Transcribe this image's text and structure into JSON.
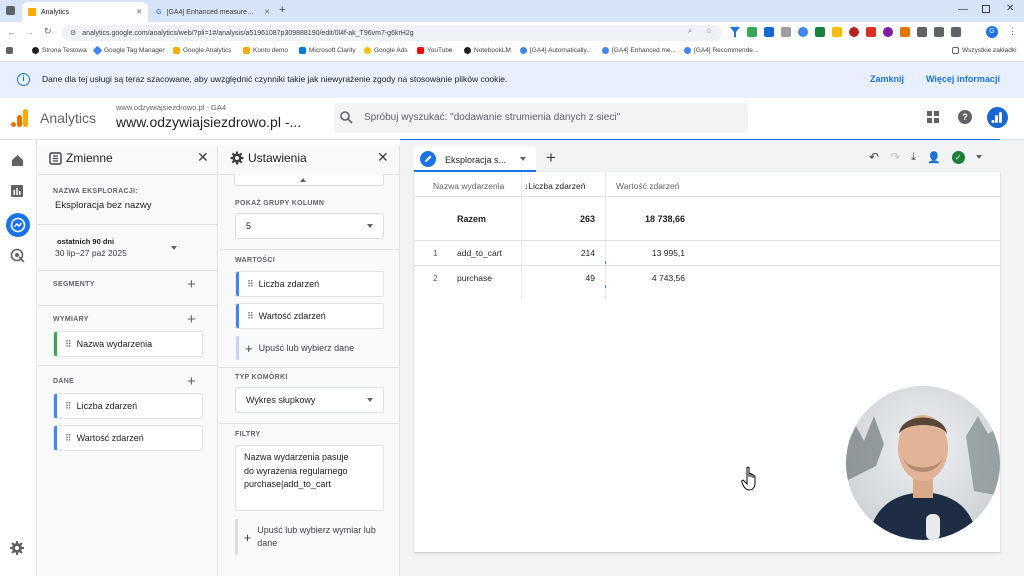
{
  "browser": {
    "tabs": [
      {
        "label": "Analytics",
        "active": true
      },
      {
        "label": "[GA4] Enhanced measurement",
        "active": false
      }
    ],
    "url": "analytics.google.com/analytics/web/?pli=1#/analysis/a51961087p309888190/edit/0l4f-ak_T96vm7-g6krH2g",
    "bookmarks": [
      "Strona Testowa",
      "Google Tag Manager",
      "Google Analytics",
      "Konto demo",
      "Microsoft Clarity",
      "Google Ads",
      "YouTube",
      "NotebookLM",
      "[GA4] Automatically...",
      "[GA4] Enhanced me...",
      "[GA4] Recommende..."
    ],
    "all_bookmarks": "Wszystkie zakładki",
    "profile_initial": "G"
  },
  "banner": {
    "text": "Dane dla tej usługi są teraz szacowane, aby uwzględnić czynniki takie jak niewyrażenie zgody na stosowanie plików cookie.",
    "close_label": "Zamknij",
    "more_label": "Więcej informacji"
  },
  "header": {
    "app_name": "Analytics",
    "property_small": "www.odzywiajsiezdrowo.pl - GA4",
    "property_big": "www.odzywiajsiezdrowo.pl -...",
    "search_placeholder": "Spróbuj wyszukać: \"dodawanie strumienia danych z sieci\""
  },
  "variables_panel": {
    "title": "Zmienne",
    "exploration_name_label": "NAZWA EKSPLORACJI:",
    "exploration_name": "Eksploracja bez nazwy",
    "date_range_label": "ostatnich 90 dni",
    "date_range": "30 lip–27 paź 2025",
    "segments_label": "SEGMENTY",
    "dimensions_label": "WYMIARY",
    "dimensions": [
      "Nazwa wydarzenia"
    ],
    "metrics_label": "DANE",
    "metrics": [
      "Liczba zdarzeń",
      "Wartość zdarzeń"
    ]
  },
  "settings_panel": {
    "title": "Ustawienia",
    "column_groups_label": "POKAŻ GRUPY KOLUMN",
    "column_groups_value": "5",
    "values_label": "WARTOŚCI",
    "values": [
      "Liczba zdarzeń",
      "Wartość zdarzeń"
    ],
    "drop_label": "Upuść lub wybierz dane",
    "cell_type_label": "TYP KOMÓRKI",
    "cell_type_value": "Wykres słupkowy",
    "filters_label": "FILTRY",
    "filter_text": "Nazwa wydarzenia pasuje do wyrażenia regularnego purchase|add_to_cart",
    "drop_dimension_label": "Upuść lub wybierz wymiar lub dane"
  },
  "tab": {
    "label": "Eksploracja s...",
    "add_label": "+"
  },
  "table": {
    "headers": [
      "Nazwa wydarzenia",
      "↓Liczba zdarzeń",
      "Wartość zdarzeń"
    ],
    "total": {
      "label": "Razem",
      "count": "263",
      "value": "18 738,66"
    },
    "rows": [
      {
        "idx": "1",
        "name": "add_to_cart",
        "count": "214",
        "value": "13 995,1"
      },
      {
        "idx": "2",
        "name": "purchase",
        "count": "49",
        "value": "4 743,56"
      }
    ]
  },
  "colors": {
    "accent": "#1a73e8",
    "dimension_bar": "#34a853",
    "metric_bar": "#4285f4",
    "banner_bg": "#e8f0fe",
    "ga_orange": "#f9ab00",
    "ga_dark_orange": "#e37400"
  }
}
